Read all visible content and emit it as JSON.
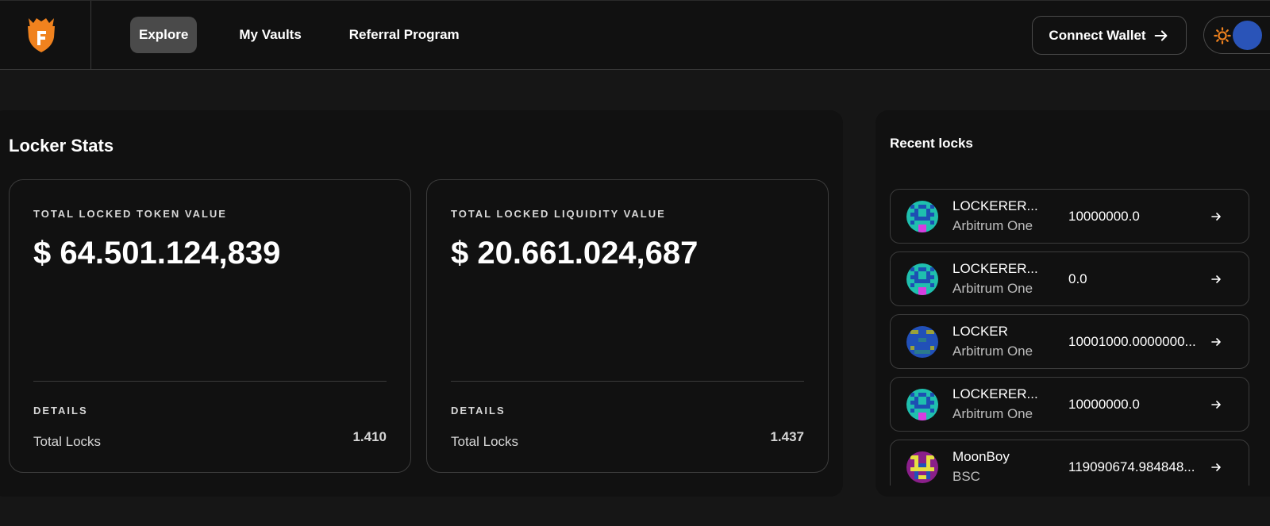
{
  "nav": {
    "items": [
      {
        "label": "Explore",
        "active": true
      },
      {
        "label": "My Vaults",
        "active": false
      },
      {
        "label": "Referral Program",
        "active": false
      }
    ],
    "connect_label": "Connect Wallet",
    "theme": "dark"
  },
  "colors": {
    "accent_orange": "#f0821e",
    "toggle_blue": "#2a54b8",
    "background": "#161616",
    "panel": "#111111"
  },
  "stats": {
    "title": "Locker Stats",
    "cards": [
      {
        "label": "TOTAL LOCKED TOKEN VALUE",
        "value": "$ 64.501.124,839",
        "details_label": "DETAILS",
        "row_label": "Total Locks",
        "row_value": "1.410"
      },
      {
        "label": "TOTAL LOCKED LIQUIDITY VALUE",
        "value": "$ 20.661.024,687",
        "details_label": "DETAILS",
        "row_label": "Total Locks",
        "row_value": "1.437"
      }
    ]
  },
  "recent": {
    "title": "Recent locks",
    "items": [
      {
        "name": "LOCKERER...",
        "chain": "Arbitrum One",
        "amount": "10000000.0",
        "avatar": "pixel-green"
      },
      {
        "name": "LOCKERER...",
        "chain": "Arbitrum One",
        "amount": "0.0",
        "avatar": "pixel-green"
      },
      {
        "name": "LOCKER",
        "chain": "Arbitrum One",
        "amount": "10001000.0000000...",
        "avatar": "pixel-blue"
      },
      {
        "name": "LOCKERER...",
        "chain": "Arbitrum One",
        "amount": "10000000.0",
        "avatar": "pixel-green"
      },
      {
        "name": "MoonBoy",
        "chain": "BSC",
        "amount": "119090674.984848...",
        "avatar": "pixel-yellow"
      }
    ]
  }
}
